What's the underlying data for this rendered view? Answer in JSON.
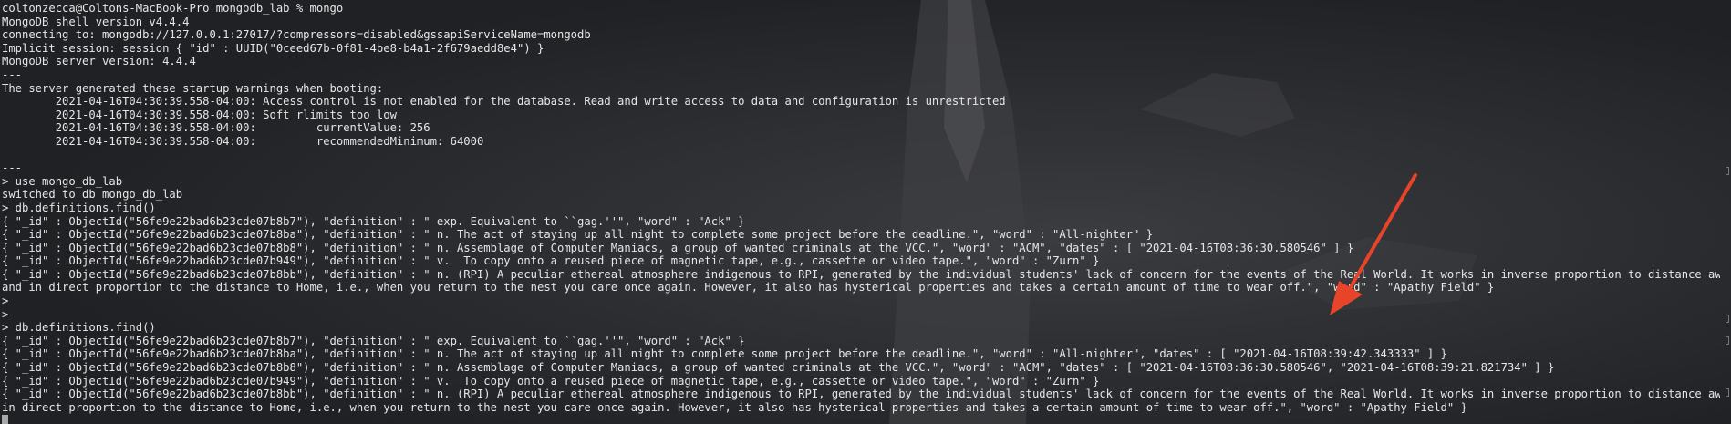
{
  "terminal": {
    "lines": [
      "coltonzecca@Coltons-MacBook-Pro mongodb_lab % mongo",
      "MongoDB shell version v4.4.4",
      "connecting to: mongodb://127.0.0.1:27017/?compressors=disabled&gssapiServiceName=mongodb",
      "Implicit session: session { \"id\" : UUID(\"0ceed67b-0f81-4be8-b4a1-2f679aedd8e4\") }",
      "MongoDB server version: 4.4.4",
      "---",
      "The server generated these startup warnings when booting:",
      "        2021-04-16T04:30:39.558-04:00: Access control is not enabled for the database. Read and write access to data and configuration is unrestricted",
      "        2021-04-16T04:30:39.558-04:00: Soft rlimits too low",
      "        2021-04-16T04:30:39.558-04:00:         currentValue: 256",
      "        2021-04-16T04:30:39.558-04:00:         recommendedMinimum: 64000",
      "",
      "---",
      "> use mongo_db_lab",
      "switched to db mongo_db_lab",
      "> db.definitions.find()",
      "{ \"_id\" : ObjectId(\"56fe9e22bad6b23cde07b8b7\"), \"definition\" : \" exp. Equivalent to ``gag.''\", \"word\" : \"Ack\" }",
      "{ \"_id\" : ObjectId(\"56fe9e22bad6b23cde07b8ba\"), \"definition\" : \" n. The act of staying up all night to complete some project before the deadline.\", \"word\" : \"All-nighter\" }",
      "{ \"_id\" : ObjectId(\"56fe9e22bad6b23cde07b8b8\"), \"definition\" : \" n. Assemblage of Computer Maniacs, a group of wanted criminals at the VCC.\", \"word\" : \"ACM\", \"dates\" : [ \"2021-04-16T08:36:30.580546\" ] }",
      "{ \"_id\" : ObjectId(\"56fe9e22bad6b23cde07b949\"), \"definition\" : \" v.  To copy onto a reused piece of magnetic tape, e.g., cassette or video tape.\", \"word\" : \"Zurn\" }",
      "{ \"_id\" : ObjectId(\"56fe9e22bad6b23cde07b8bb\"), \"definition\" : \" n. (RPI) A peculiar ethereal atmosphere indigenous to RPI, generated by the individual students' lack of concern for the events of the Real World. It works in inverse proportion to distance away from Troy",
      "and in direct proportion to the distance to Home, i.e., when you return to the nest you care once again. However, it also has hysterical properties and takes a certain amount of time to wear off.\", \"word\" : \"Apathy Field\" }",
      ">",
      ">",
      "> db.definitions.find()",
      "{ \"_id\" : ObjectId(\"56fe9e22bad6b23cde07b8b7\"), \"definition\" : \" exp. Equivalent to ``gag.''\", \"word\" : \"Ack\" }",
      "{ \"_id\" : ObjectId(\"56fe9e22bad6b23cde07b8ba\"), \"definition\" : \" n. The act of staying up all night to complete some project before the deadline.\", \"word\" : \"All-nighter\", \"dates\" : [ \"2021-04-16T08:39:42.343333\" ] }",
      "{ \"_id\" : ObjectId(\"56fe9e22bad6b23cde07b8b8\"), \"definition\" : \" n. Assemblage of Computer Maniacs, a group of wanted criminals at the VCC.\", \"word\" : \"ACM\", \"dates\" : [ \"2021-04-16T08:36:30.580546\", \"2021-04-16T08:39:21.821734\" ] }",
      "{ \"_id\" : ObjectId(\"56fe9e22bad6b23cde07b949\"), \"definition\" : \" v.  To copy onto a reused piece of magnetic tape, e.g., cassette or video tape.\", \"word\" : \"Zurn\" }",
      "{ \"_id\" : ObjectId(\"56fe9e22bad6b23cde07b8bb\"), \"definition\" : \" n. (RPI) A peculiar ethereal atmosphere indigenous to RPI, generated by the individual students' lack of concern for the events of the Real World. It works in inverse proportion to distance away from Troy",
      "in direct proportion to the distance to Home, i.e., when you return to the nest you care once again. However, it also has hysterical properties and takes a certain amount of time to wear off.\", \"word\" : \"Apathy Field\" }"
    ],
    "prompt_line": ""
  },
  "colors": {
    "text": "#e6e6e6",
    "background": "#26272a",
    "arrow": "#e8442a",
    "cursor": "#a8a8a8"
  },
  "icons": {
    "annotation": "arrow-icon",
    "caret": "cursor-icon"
  }
}
